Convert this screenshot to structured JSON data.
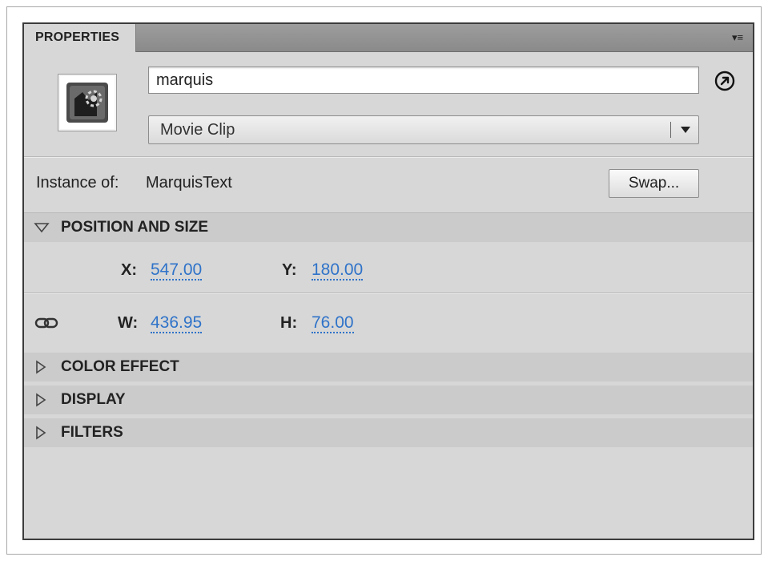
{
  "panel": {
    "tab_label": "PROPERTIES",
    "menu_icon": "panel-menu-icon"
  },
  "symbol": {
    "icon": "movie-clip-symbol-icon",
    "instance_name": "marquis",
    "goto_icon": "go-to-source-icon",
    "type_selected": "Movie Clip"
  },
  "instance": {
    "label": "Instance of:",
    "value": "MarquisText",
    "swap_label": "Swap..."
  },
  "position_and_size": {
    "title": "POSITION AND SIZE",
    "expanded": true,
    "x_label": "X:",
    "x_value": "547.00",
    "y_label": "Y:",
    "y_value": "180.00",
    "w_label": "W:",
    "w_value": "436.95",
    "h_label": "H:",
    "h_value": "76.00",
    "lock_icon": "link-icon"
  },
  "collapsed_sections": [
    {
      "title": "COLOR EFFECT"
    },
    {
      "title": "DISPLAY"
    },
    {
      "title": "FILTERS"
    }
  ],
  "colors": {
    "value_blue": "#2f73c9",
    "panel_bg": "#d7d7d7",
    "section_bg": "#cbcbcb"
  }
}
